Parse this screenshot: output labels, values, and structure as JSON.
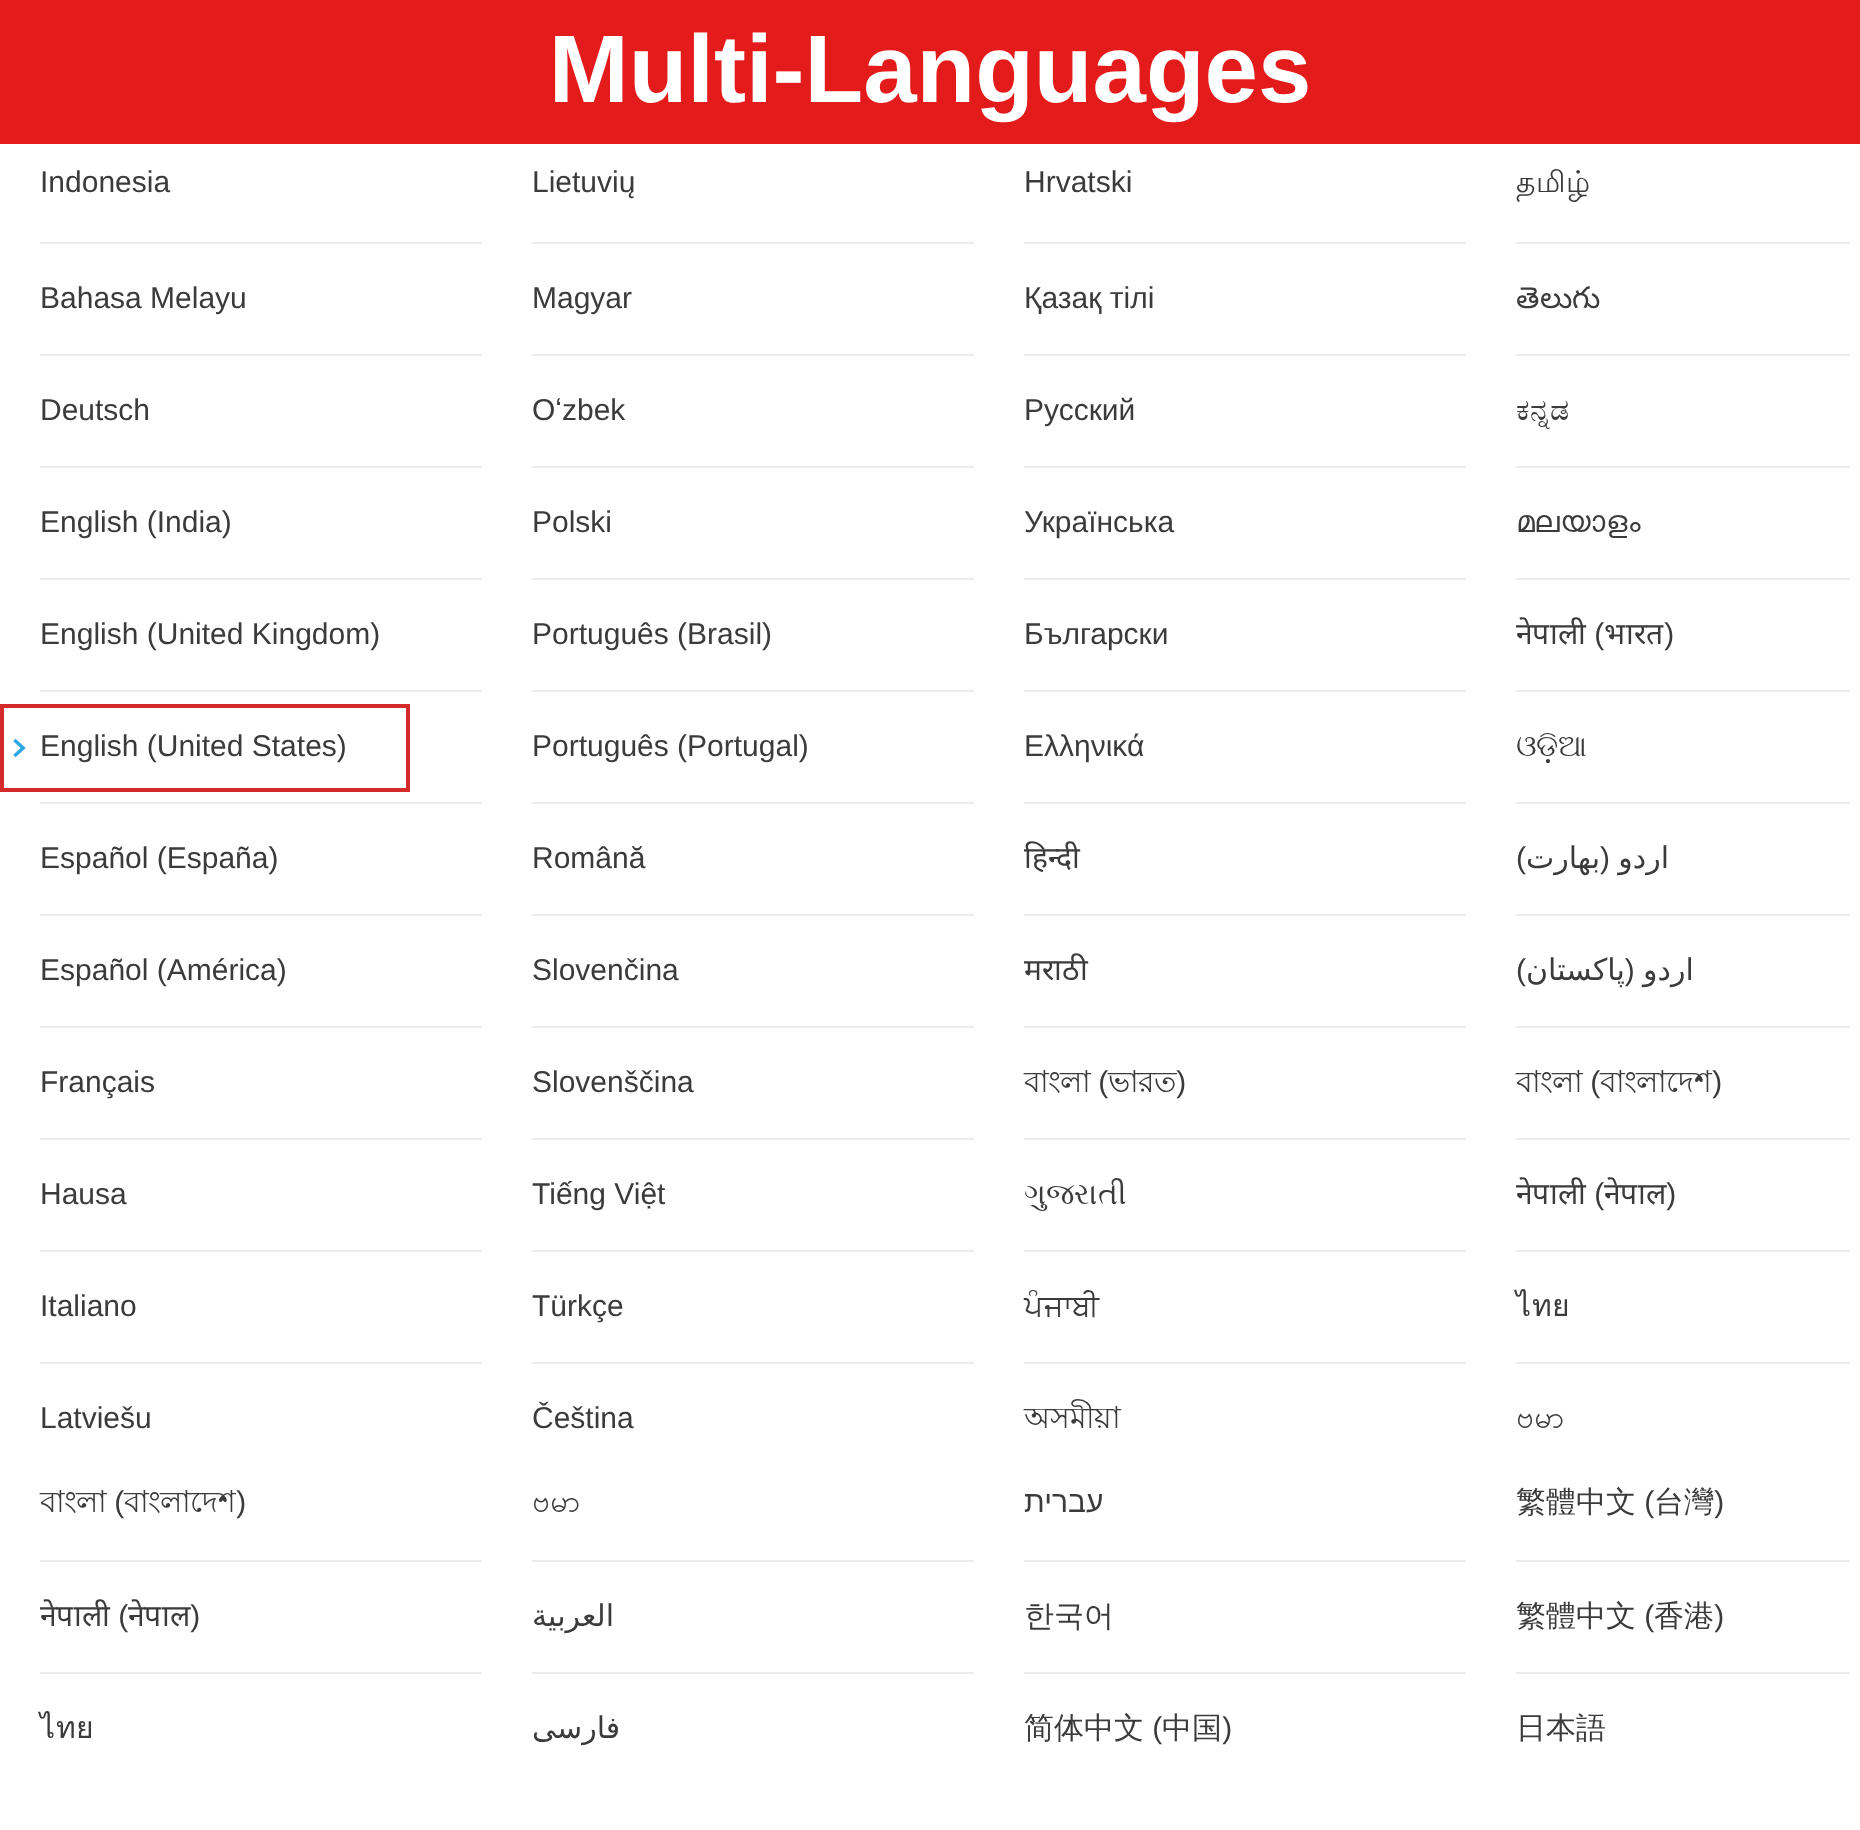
{
  "header": {
    "title": "Multi-Languages"
  },
  "columns": [
    {
      "items": [
        {
          "label": "Indonesia",
          "selected": false
        },
        {
          "label": "Bahasa Melayu",
          "selected": false
        },
        {
          "label": "Deutsch",
          "selected": false
        },
        {
          "label": "English (India)",
          "selected": false
        },
        {
          "label": "English (United Kingdom)",
          "selected": false
        },
        {
          "label": "English (United States)",
          "selected": true
        },
        {
          "label": "Español (España)",
          "selected": false
        },
        {
          "label": "Español (América)",
          "selected": false
        },
        {
          "label": "Français",
          "selected": false
        },
        {
          "label": "Hausa",
          "selected": false
        },
        {
          "label": "Italiano",
          "selected": false
        },
        {
          "label": "Latviešu",
          "selected": false
        },
        {
          "label": "বাংলা (বাংলাদেশ)",
          "selected": false
        },
        {
          "label": "नेपाली (नेपाल)",
          "selected": false
        },
        {
          "label": "ไทย",
          "selected": false
        }
      ]
    },
    {
      "items": [
        {
          "label": "Lietuvių",
          "selected": false
        },
        {
          "label": "Magyar",
          "selected": false
        },
        {
          "label": "Oʻzbek",
          "selected": false
        },
        {
          "label": "Polski",
          "selected": false
        },
        {
          "label": "Português (Brasil)",
          "selected": false
        },
        {
          "label": "Português (Portugal)",
          "selected": false
        },
        {
          "label": "Română",
          "selected": false
        },
        {
          "label": "Slovenčina",
          "selected": false
        },
        {
          "label": "Slovenščina",
          "selected": false
        },
        {
          "label": "Tiếng Việt",
          "selected": false
        },
        {
          "label": "Türkçe",
          "selected": false
        },
        {
          "label": "Čeština",
          "selected": false
        },
        {
          "label": "ဗမာ",
          "selected": false
        },
        {
          "label": "العربية",
          "selected": false
        },
        {
          "label": "فارسی",
          "selected": false
        }
      ]
    },
    {
      "items": [
        {
          "label": "Hrvatski",
          "selected": false
        },
        {
          "label": "Қазақ тілі",
          "selected": false
        },
        {
          "label": "Русский",
          "selected": false
        },
        {
          "label": "Українська",
          "selected": false
        },
        {
          "label": "Български",
          "selected": false
        },
        {
          "label": "Ελληνικά",
          "selected": false
        },
        {
          "label": "हिन्दी",
          "selected": false
        },
        {
          "label": "मराठी",
          "selected": false
        },
        {
          "label": "বাংলা (ভারত)",
          "selected": false
        },
        {
          "label": "ગુજરાતી",
          "selected": false
        },
        {
          "label": "ਪੰਜਾਬੀ",
          "selected": false
        },
        {
          "label": "অসমীয়া",
          "selected": false
        },
        {
          "label": "עברית",
          "selected": false
        },
        {
          "label": "한국어",
          "selected": false
        },
        {
          "label": "简体中文 (中国)",
          "selected": false
        }
      ]
    },
    {
      "items": [
        {
          "label": "தமிழ்",
          "selected": false
        },
        {
          "label": "తెలుగు",
          "selected": false
        },
        {
          "label": "ಕನ್ನಡ",
          "selected": false
        },
        {
          "label": "മലയാളം",
          "selected": false
        },
        {
          "label": "नेपाली (भारत)",
          "selected": false
        },
        {
          "label": "ଓଡ଼ିଆ",
          "selected": false
        },
        {
          "label": "اردو (بھارت)",
          "selected": false
        },
        {
          "label": "اردو (پاکستان)",
          "selected": false
        },
        {
          "label": "বাংলা (বাংলাদেশ)",
          "selected": false
        },
        {
          "label": "नेपाली (नेपाल)",
          "selected": false
        },
        {
          "label": "ไทย",
          "selected": false
        },
        {
          "label": "ဗမာ",
          "selected": false
        },
        {
          "label": "繁體中文 (台灣)",
          "selected": false
        },
        {
          "label": "繁體中文 (香港)",
          "selected": false
        },
        {
          "label": "日本語",
          "selected": false
        }
      ]
    }
  ]
}
